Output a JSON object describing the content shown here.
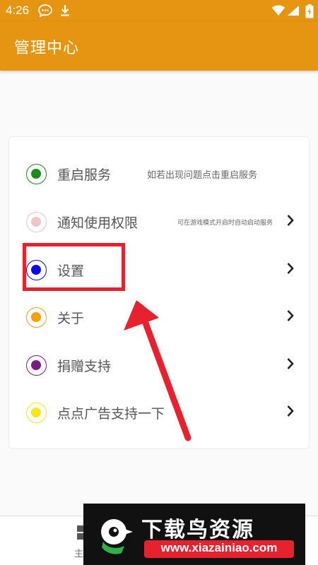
{
  "status_bar": {
    "time": "4:26",
    "icons": [
      "message-icon",
      "download-icon",
      "wifi-icon",
      "signal-icon",
      "battery-icon"
    ]
  },
  "app_bar": {
    "title": "管理中心",
    "color": "#e69512"
  },
  "menu": {
    "items": [
      {
        "label": "重启服务",
        "description": "如若出现问题点击重启服务",
        "radio_color": "#1b8a1b",
        "has_chevron": false
      },
      {
        "label": "通知使用权限",
        "description": "可在游戏模式开启时自动启动服务",
        "radio_color": "#f6c2c9",
        "has_chevron": true
      },
      {
        "label": "设置",
        "description": "",
        "radio_color": "#0a0aea",
        "has_chevron": true
      },
      {
        "label": "关于",
        "description": "",
        "radio_color": "#f5a00a",
        "has_chevron": true
      },
      {
        "label": "捐赠支持",
        "description": "",
        "radio_color": "#7a1a82",
        "has_chevron": true
      },
      {
        "label": "点点广告支持一下",
        "description": "",
        "radio_color": "#f5e81a",
        "has_chevron": true
      }
    ]
  },
  "bottom_bar": {
    "tab_label": "主"
  },
  "annotation": {
    "color": "#e8212f"
  },
  "watermark": {
    "title": "下载鸟资源",
    "url": "www.xiazainiao.com"
  }
}
